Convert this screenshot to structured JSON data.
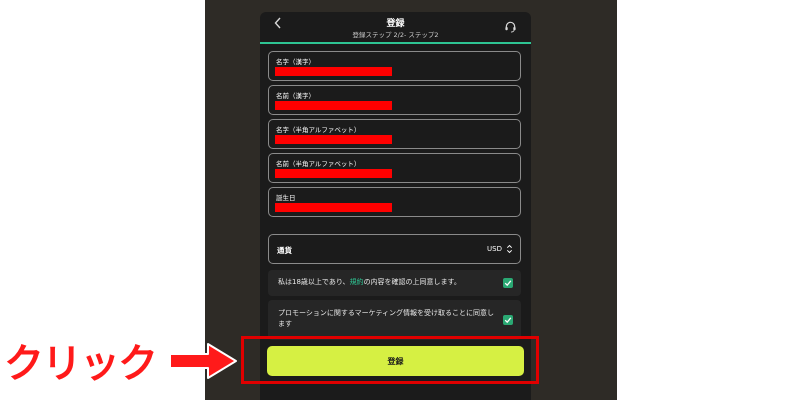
{
  "header": {
    "back_icon": "chevron-left-icon",
    "title": "登録",
    "subtitle": "登録ステップ 2/2- ステップ2",
    "support_icon": "headset-icon"
  },
  "form": {
    "fields": [
      {
        "label": "名字（漢字）"
      },
      {
        "label": "名前（漢字）"
      },
      {
        "label": "名字（半角アルファベット）"
      },
      {
        "label": "名前（半角アルファベット）"
      },
      {
        "label": "誕生日"
      }
    ],
    "currency": {
      "label": "通貨",
      "value": "USD",
      "icon": "up-down-chevron-icon"
    },
    "age_consent": {
      "before": "私は18歳以上であり、",
      "link": "規約",
      "after": "の内容を確認の上同意します。",
      "checked": true
    },
    "promo_consent": {
      "text": "プロモーションに関するマーケティング情報を受け取ることに同意します",
      "checked": true
    },
    "submit_label": "登録"
  },
  "annotation": {
    "click_label": "クリック",
    "highlight_color": "#e00000"
  },
  "colors": {
    "accent": "#2ec493",
    "submit": "#d6f043",
    "redaction": "#ff0000",
    "checkbox": "#2aa873"
  }
}
